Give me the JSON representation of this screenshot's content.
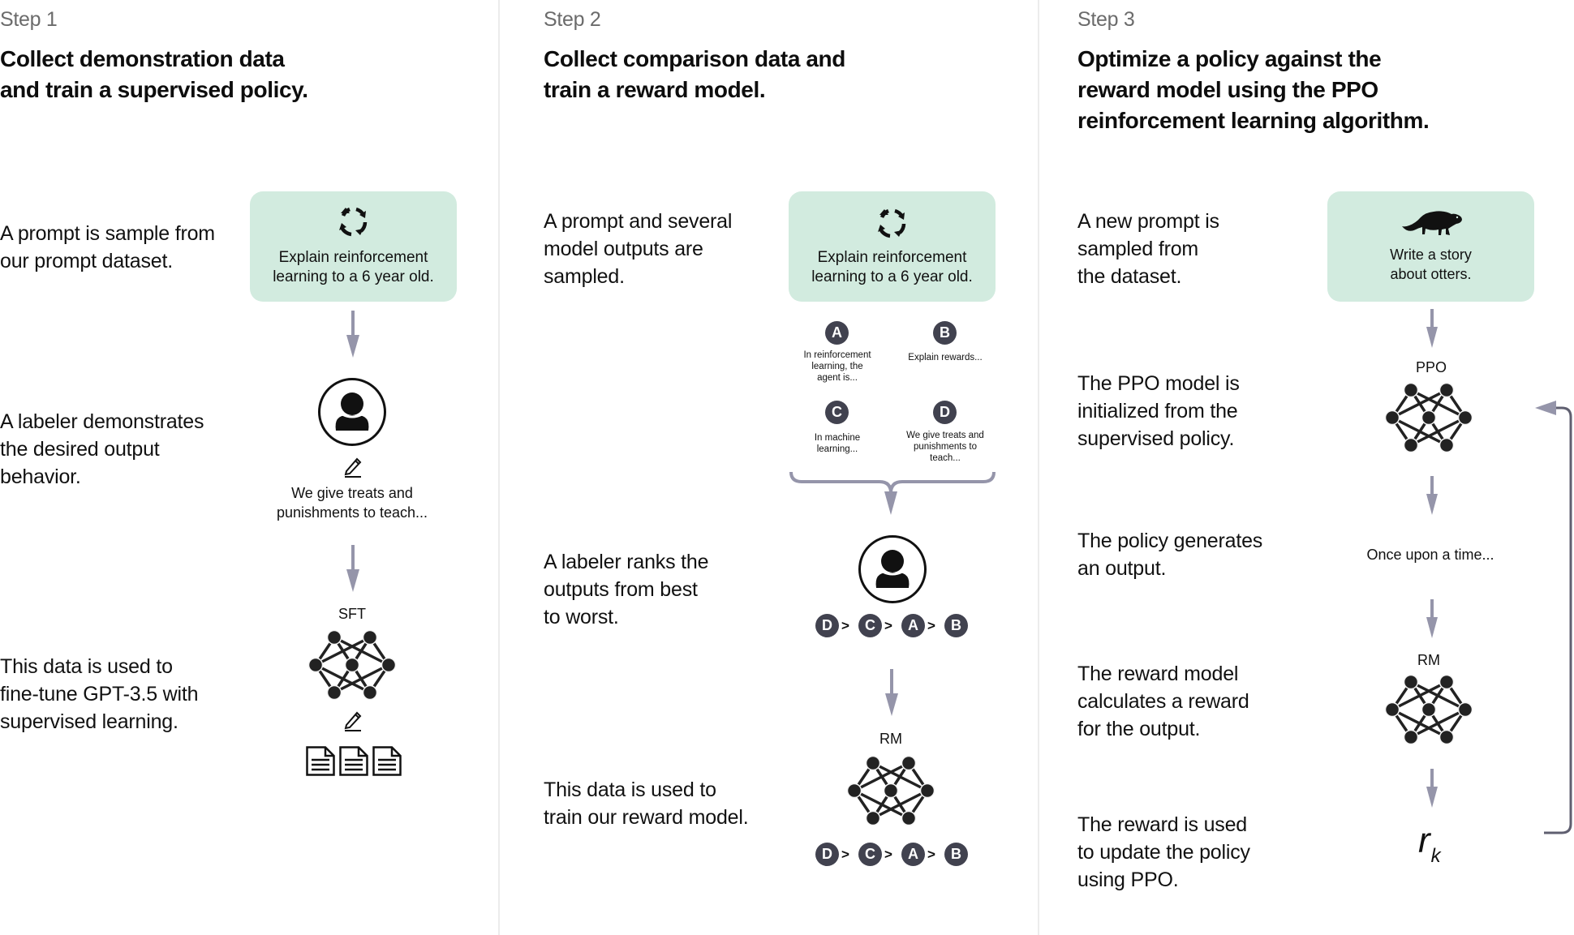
{
  "colors": {
    "prompt_box": "#d2ebdf",
    "arrow": "#9595aa",
    "badge": "#41424f",
    "loop_arrow": "#5f5f70",
    "divider": "#ececec"
  },
  "step1": {
    "label": "Step 1",
    "title_lines": [
      "Collect demonstration data",
      "and train a supervised policy."
    ],
    "desc1_lines": [
      "A prompt is sample from",
      "our prompt dataset."
    ],
    "prompt_icon": "refresh-cycle-icon",
    "prompt_lines": [
      "Explain reinforcement",
      "learning to a 6 year old."
    ],
    "desc2_lines": [
      "A labeler demonstrates",
      "the desired output",
      "behavior."
    ],
    "labeler_icon": "person-icon",
    "edit_icon": "pencil-icon",
    "demo_lines": [
      "We give treats and",
      "punishments to teach..."
    ],
    "desc3_lines": [
      "This data is used to",
      "fine-tune GPT-3.5 with",
      "supervised learning."
    ],
    "model_label": "SFT",
    "docs_icon": "document-icon"
  },
  "step2": {
    "label": "Step 2",
    "title_lines": [
      "Collect comparison data and",
      "train a reward model."
    ],
    "desc1_lines": [
      "A prompt and several",
      "model outputs are",
      "sampled."
    ],
    "prompt_lines": [
      "Explain reinforcement",
      "learning to a 6 year old."
    ],
    "outputs": [
      {
        "id": "A",
        "lines": [
          "In reinforcement",
          "learning, the",
          "agent is..."
        ]
      },
      {
        "id": "B",
        "lines": [
          "Explain rewards..."
        ]
      },
      {
        "id": "C",
        "lines": [
          "In machine",
          "learning..."
        ]
      },
      {
        "id": "D",
        "lines": [
          "We give treats and",
          "punishments to",
          "teach..."
        ]
      }
    ],
    "desc2_lines": [
      "A labeler ranks the",
      "outputs from best",
      "to worst."
    ],
    "ranking": [
      "D",
      "C",
      "A",
      "B"
    ],
    "ranking_sep": ">",
    "desc3_lines": [
      "This data is used to",
      "train our reward model."
    ],
    "model_label": "RM"
  },
  "step3": {
    "label": "Step 3",
    "title_lines": [
      "Optimize a policy against the",
      "reward model using the PPO",
      "reinforcement learning algorithm."
    ],
    "desc1_lines": [
      "A new prompt is",
      "sampled from",
      "the dataset."
    ],
    "prompt_icon": "otter-icon",
    "prompt_lines": [
      "Write a story",
      "about otters."
    ],
    "desc2_lines": [
      "The PPO model is",
      "initialized from the",
      "supervised policy."
    ],
    "policy_label": "PPO",
    "desc3_lines": [
      "The policy generates",
      "an output."
    ],
    "output_text": "Once upon a time...",
    "desc4_lines": [
      "The reward model",
      "calculates a reward",
      "for the output."
    ],
    "rm_label": "RM",
    "desc5_lines": [
      "The reward is used",
      "to update the policy",
      "using PPO."
    ],
    "reward_symbol": "r",
    "reward_subscript": "k"
  }
}
